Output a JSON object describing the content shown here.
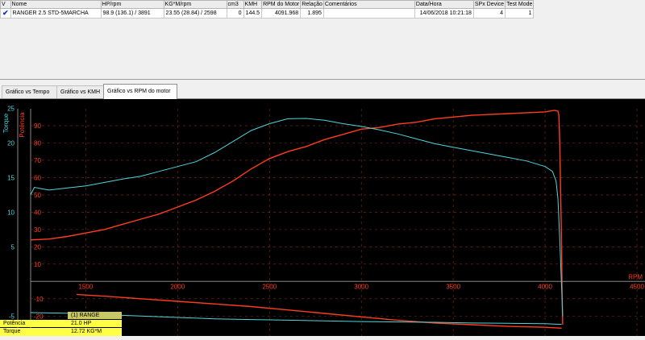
{
  "table": {
    "headers": [
      "V",
      "Nome",
      "HP/rpm",
      "KG*M/rpm",
      "cm3",
      "KMH",
      "RPM do Motor",
      "Relação",
      "Comentários",
      "Data/Hora",
      "SPx Device",
      "Test Mode"
    ],
    "row": {
      "check": "✔",
      "nome": "RANGER 2.5 STD-5MARCHA",
      "hp": "98.9 (136.1) / 3891",
      "kgm": "23.55 (28.84) / 2598",
      "cm3": "0",
      "kmh": "144.5",
      "rpm": "4091.968",
      "relacao": "1.895",
      "comentarios": "",
      "data": "14/06/2018 10:21:18",
      "spx": "4",
      "mode": "1"
    }
  },
  "tabs": [
    "Gráfico vs Tempo",
    "Gráfico vs KMH",
    "Gráfico vs RPM do motor"
  ],
  "active_tab": 2,
  "legend": {
    "title": "(1) RANGE",
    "rows": [
      {
        "label": "Potência",
        "value": "21.0 HP"
      },
      {
        "label": "Torque",
        "value": "12.72 KG*M"
      }
    ]
  },
  "colors": {
    "potencia": "#ff3d1f",
    "torque": "#4fd6dc",
    "legend_bg": "#ffff44",
    "legend_title_bg": "#c8c864",
    "hp_cell": "#ff3a1a",
    "kgm_cell": "#3ee8e0"
  },
  "chart_data": {
    "type": "line",
    "xlabel": "RPM",
    "left_axis_label": "Potência",
    "right_axis_label": "Torque",
    "x_ticks": [
      1500,
      2000,
      2500,
      3000,
      3500,
      4000,
      4500
    ],
    "xlim": [
      1200,
      4500
    ],
    "potencia_ticks": [
      -20,
      -10,
      10,
      20,
      30,
      40,
      50,
      60,
      70,
      80,
      90
    ],
    "potencia_lim": [
      -25,
      97
    ],
    "torque_ticks": [
      -5,
      5,
      10,
      15,
      20,
      25
    ],
    "torque_lim": [
      -6.25,
      24.25
    ],
    "series": [
      {
        "name": "Potência",
        "axis": "potencia",
        "x": [
          1200,
          1300,
          1400,
          1500,
          1600,
          1700,
          1800,
          1900,
          2000,
          2100,
          2200,
          2300,
          2400,
          2500,
          2600,
          2700,
          2800,
          2900,
          3000,
          3100,
          3200,
          3300,
          3400,
          3500,
          3600,
          3700,
          3800,
          3900,
          4000,
          4050,
          4070,
          4075,
          4080,
          4085,
          4090,
          4092,
          4094,
          4096
        ],
        "y": [
          24,
          24.5,
          26,
          28,
          30,
          33,
          36,
          39,
          43,
          47,
          52,
          58,
          65,
          71,
          75,
          78,
          82,
          85,
          88,
          89,
          91,
          92,
          94,
          95,
          96,
          96.5,
          97,
          97.5,
          98,
          98.9,
          98.5,
          96,
          80,
          50,
          20,
          0,
          -15,
          -25
        ]
      },
      {
        "name": "Torque",
        "axis": "torque",
        "x": [
          1200,
          1220,
          1260,
          1300,
          1400,
          1500,
          1600,
          1700,
          1800,
          1900,
          2000,
          2100,
          2200,
          2300,
          2400,
          2500,
          2600,
          2700,
          2800,
          2900,
          3000,
          3100,
          3200,
          3300,
          3400,
          3500,
          3600,
          3700,
          3800,
          3900,
          4000,
          4040,
          4060,
          4070,
          4080,
          4090,
          4096
        ],
        "y": [
          12.5,
          13.6,
          13.4,
          13.2,
          13.5,
          13.8,
          14.3,
          14.8,
          15.2,
          15.9,
          16.6,
          17.3,
          18.6,
          20.2,
          21.8,
          22.8,
          23.5,
          23.55,
          23.3,
          22.8,
          22.4,
          21.9,
          21.3,
          20.6,
          19.9,
          19.4,
          18.9,
          18.4,
          17.9,
          17.4,
          16.6,
          15.9,
          14.5,
          12.0,
          6.0,
          -1.0,
          -5.0
        ]
      },
      {
        "name": "Potência (perdas)",
        "axis": "potencia",
        "x": [
          1450,
          1600,
          1800,
          2000,
          2200,
          2400,
          2600,
          2800,
          3000,
          3200,
          3400,
          3600,
          3800,
          4000,
          4090
        ],
        "y": [
          -7.5,
          -8.5,
          -10,
          -11.5,
          -13,
          -14.5,
          -16.5,
          -18.5,
          -20.5,
          -22.5,
          -24,
          -25,
          -26,
          -26.5,
          -27
        ]
      },
      {
        "name": "Torque (perdas)",
        "axis": "torque",
        "x": [
          1200,
          1400,
          1600,
          1800,
          2000,
          2200,
          2400,
          2600,
          2800,
          3000,
          3200,
          3400,
          3600,
          3800,
          4000,
          4090
        ],
        "y": [
          -4.5,
          -4.6,
          -4.8,
          -5.0,
          -5.2,
          -5.4,
          -5.5,
          -5.6,
          -5.7,
          -5.8,
          -5.85,
          -5.9,
          -6.0,
          -6.05,
          -6.1,
          -6.2
        ]
      }
    ]
  }
}
